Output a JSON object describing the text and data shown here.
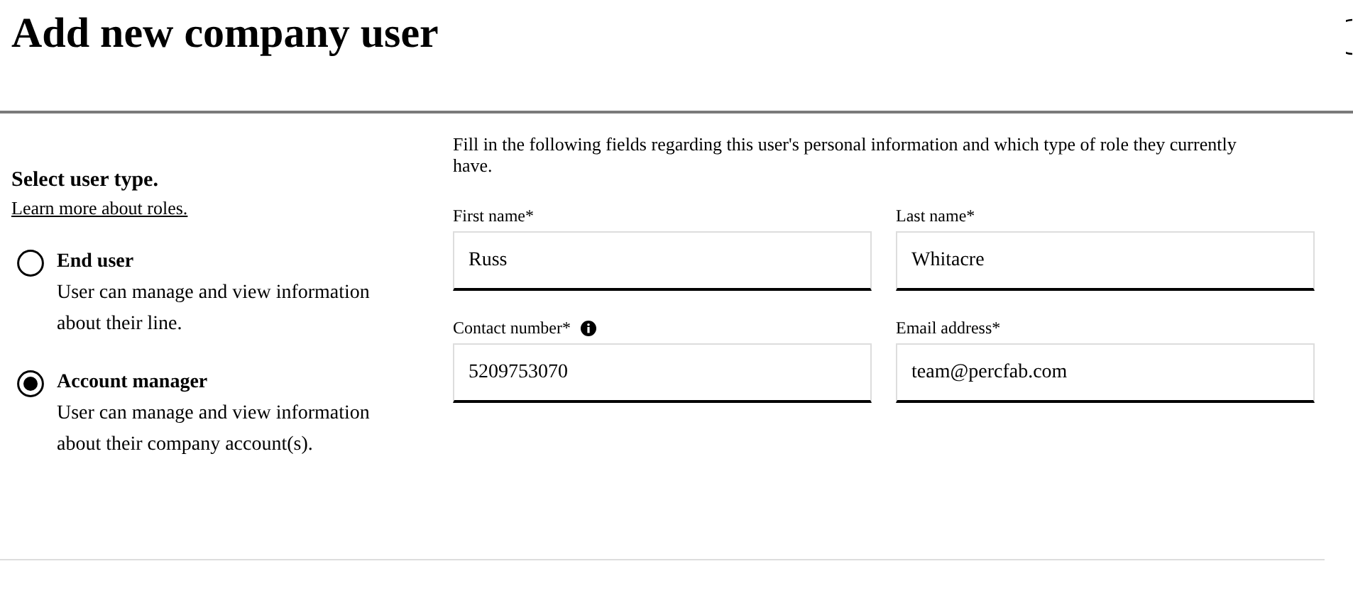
{
  "title": "Add new company user",
  "user_type": {
    "heading": "Select user type.",
    "link": "Learn more about roles.",
    "options": [
      {
        "label": "End user",
        "description": "User can manage and view information about their line.",
        "selected": false
      },
      {
        "label": "Account manager",
        "description": "User can manage and view information about their company account(s).",
        "selected": true
      }
    ]
  },
  "form": {
    "intro": "Fill in the following fields regarding this user's personal information and which type of role they currently have.",
    "fields": [
      {
        "label": "First name*",
        "value": "Russ",
        "info": false
      },
      {
        "label": "Last name*",
        "value": "Whitacre",
        "info": false
      },
      {
        "label": "Contact number*",
        "value": "5209753070",
        "info": true
      },
      {
        "label": "Email address*",
        "value": "team@percfab.com",
        "info": false
      }
    ]
  }
}
